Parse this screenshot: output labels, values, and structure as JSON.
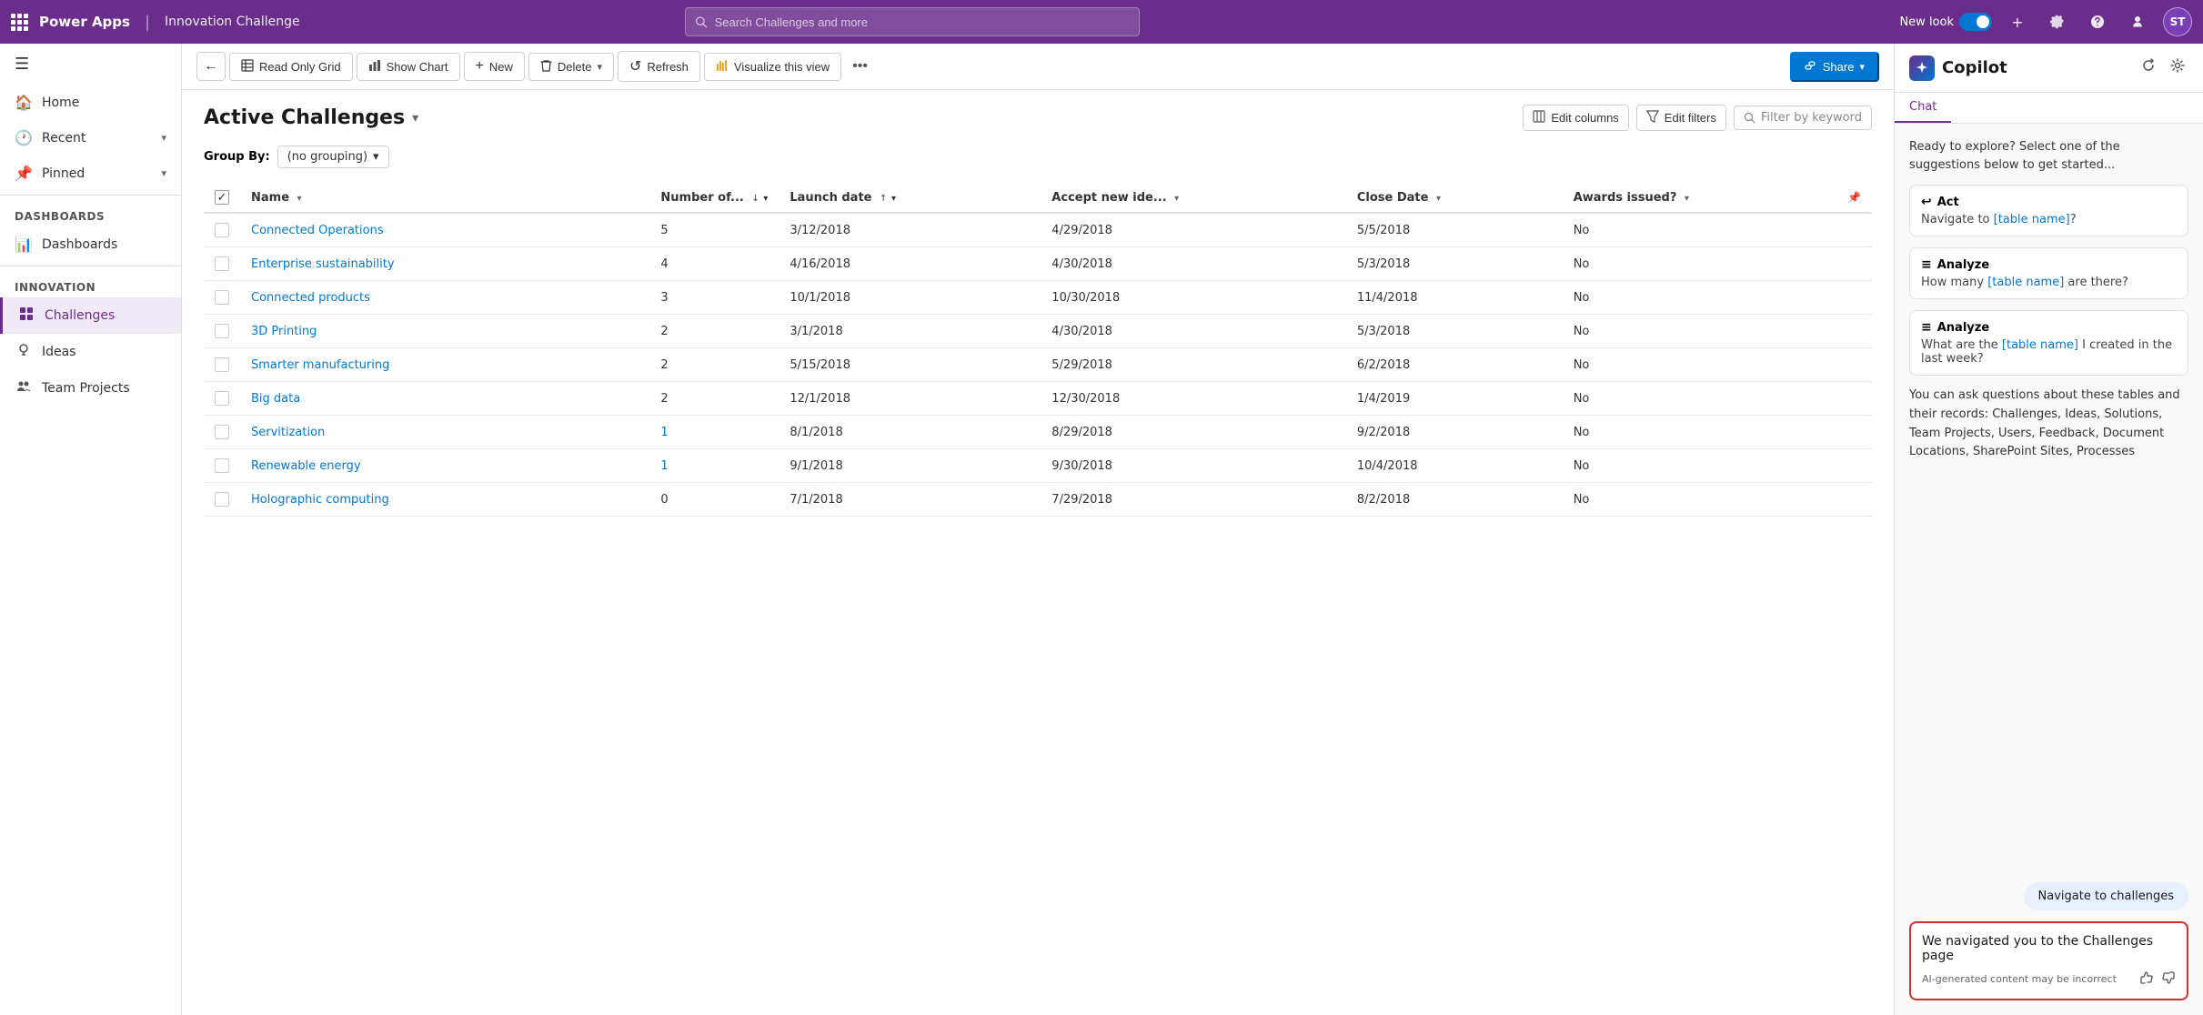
{
  "topbar": {
    "app_name": "Power Apps",
    "divider": "|",
    "instance_name": "Innovation Challenge",
    "search_placeholder": "Search Challenges and more",
    "new_look_label": "New look",
    "avatar_initials": "ST",
    "add_icon": "+",
    "settings_icon": "⚙",
    "help_icon": "?",
    "profile_icon": "👤",
    "grid_icon": "⊞"
  },
  "sidebar": {
    "toggle_icon": "☰",
    "items": [
      {
        "id": "home",
        "label": "Home",
        "icon": "🏠",
        "has_expand": false
      },
      {
        "id": "recent",
        "label": "Recent",
        "icon": "🕐",
        "has_expand": true
      },
      {
        "id": "pinned",
        "label": "Pinned",
        "icon": "📌",
        "has_expand": true
      }
    ],
    "section_dashboards": "Dashboards",
    "dashboards_item": "Dashboards",
    "dashboards_icon": "📊",
    "section_innovation": "Innovation",
    "innovation_items": [
      {
        "id": "challenges",
        "label": "Challenges",
        "icon": "🎯",
        "active": true
      },
      {
        "id": "ideas",
        "label": "Ideas",
        "icon": "💡",
        "active": false
      },
      {
        "id": "team-projects",
        "label": "Team Projects",
        "icon": "👥",
        "active": false
      }
    ]
  },
  "toolbar": {
    "back_icon": "←",
    "read_only_grid_label": "Read Only Grid",
    "read_only_grid_icon": "▦",
    "show_chart_label": "Show Chart",
    "show_chart_icon": "📊",
    "new_label": "New",
    "new_icon": "+",
    "delete_label": "Delete",
    "delete_icon": "🗑",
    "dropdown_icon": "▾",
    "refresh_label": "Refresh",
    "refresh_icon": "↺",
    "visualize_label": "Visualize this view",
    "visualize_icon": "🟡",
    "more_icon": "•••",
    "share_label": "Share",
    "share_icon": "🔗"
  },
  "view": {
    "title": "Active Challenges",
    "title_chevron": "▾",
    "edit_columns_label": "Edit columns",
    "edit_columns_icon": "⊞",
    "edit_filters_label": "Edit filters",
    "edit_filters_icon": "▽",
    "filter_placeholder": "Filter by keyword",
    "filter_icon": "🔍",
    "groupby_label": "Group By:",
    "groupby_value": "(no grouping)",
    "groupby_chevron": "▾",
    "table": {
      "columns": [
        {
          "id": "name",
          "label": "Name",
          "sort": "asc"
        },
        {
          "id": "number",
          "label": "Number of...",
          "sort": "desc"
        },
        {
          "id": "launch_date",
          "label": "Launch date",
          "sort": "asc"
        },
        {
          "id": "accept_new",
          "label": "Accept new ide...",
          "sort": "desc"
        },
        {
          "id": "close_date",
          "label": "Close Date",
          "sort": "desc"
        },
        {
          "id": "awards",
          "label": "Awards issued?",
          "sort": "desc"
        }
      ],
      "rows": [
        {
          "name": "Connected Operations",
          "number": "5",
          "number_link": false,
          "launch_date": "3/12/2018",
          "accept_new": "4/29/2018",
          "close_date": "5/5/2018",
          "awards": "No"
        },
        {
          "name": "Enterprise sustainability",
          "number": "4",
          "number_link": false,
          "launch_date": "4/16/2018",
          "accept_new": "4/30/2018",
          "close_date": "5/3/2018",
          "awards": "No"
        },
        {
          "name": "Connected products",
          "number": "3",
          "number_link": false,
          "launch_date": "10/1/2018",
          "accept_new": "10/30/2018",
          "close_date": "11/4/2018",
          "awards": "No"
        },
        {
          "name": "3D Printing",
          "number": "2",
          "number_link": false,
          "launch_date": "3/1/2018",
          "accept_new": "4/30/2018",
          "close_date": "5/3/2018",
          "awards": "No"
        },
        {
          "name": "Smarter manufacturing",
          "number": "2",
          "number_link": false,
          "launch_date": "5/15/2018",
          "accept_new": "5/29/2018",
          "close_date": "6/2/2018",
          "awards": "No"
        },
        {
          "name": "Big data",
          "number": "2",
          "number_link": false,
          "launch_date": "12/1/2018",
          "accept_new": "12/30/2018",
          "close_date": "1/4/2019",
          "awards": "No"
        },
        {
          "name": "Servitization",
          "number": "1",
          "number_link": true,
          "launch_date": "8/1/2018",
          "accept_new": "8/29/2018",
          "close_date": "9/2/2018",
          "awards": "No"
        },
        {
          "name": "Renewable energy",
          "number": "1",
          "number_link": true,
          "launch_date": "9/1/2018",
          "accept_new": "9/30/2018",
          "close_date": "10/4/2018",
          "awards": "No"
        },
        {
          "name": "Holographic computing",
          "number": "0",
          "number_link": false,
          "launch_date": "7/1/2018",
          "accept_new": "7/29/2018",
          "close_date": "8/2/2018",
          "awards": "No"
        }
      ]
    }
  },
  "copilot": {
    "title": "Copilot",
    "logo_icon": "✦",
    "refresh_icon": "↺",
    "settings_icon": "⚙",
    "tabs": [
      {
        "id": "chat",
        "label": "Chat",
        "active": true
      }
    ],
    "intro_text": "Ready to explore? Select one of the suggestions below to get started...",
    "suggestions": [
      {
        "id": "act",
        "type_icon": "↩",
        "type_label": "Act",
        "text_before": "Navigate to ",
        "link_text": "[table name]",
        "text_after": "?"
      },
      {
        "id": "analyze1",
        "type_icon": "≡",
        "type_label": "Analyze",
        "text_before": "How many ",
        "link_text": "[table name]",
        "text_after": " are there?"
      },
      {
        "id": "analyze2",
        "type_icon": "≡",
        "type_label": "Analyze",
        "text_before": "What are the ",
        "link_text": "[table name]",
        "text_after": " I created in the last week?"
      }
    ],
    "info_text": "You can ask questions about these tables and their records: Challenges, Ideas, Solutions, Team Projects, Users, Feedback, Document Locations, SharePoint Sites, Processes",
    "navigate_bubble": "Navigate to challenges",
    "response_text": "We navigated you to the Challenges page",
    "response_disclaimer": "AI-generated content may be incorrect",
    "thumbs_up_icon": "👍",
    "thumbs_down_icon": "👎"
  }
}
